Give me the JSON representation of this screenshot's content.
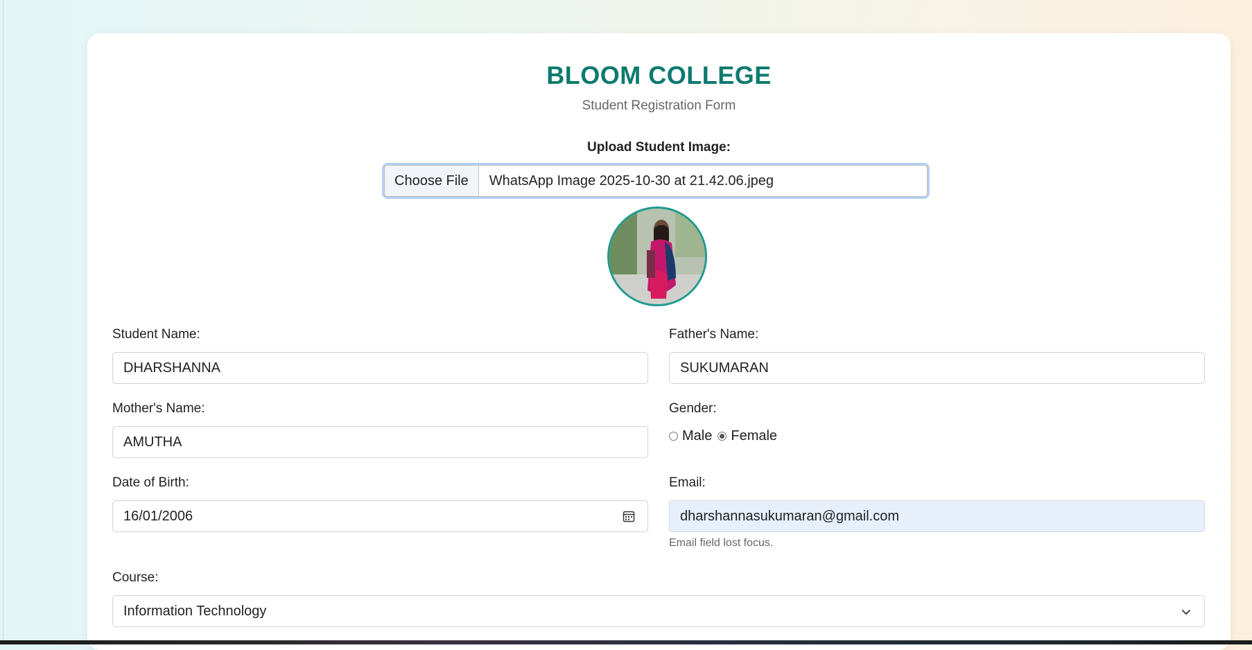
{
  "header": {
    "title": "BLOOM COLLEGE",
    "subtitle": "Student Registration Form"
  },
  "upload": {
    "label": "Upload Student Image:",
    "button_label": "Choose File",
    "file_name": "WhatsApp Image 2025-10-30 at 21.42.06.jpeg"
  },
  "fields": {
    "student_name": {
      "label": "Student Name:",
      "value": "DHARSHANNA"
    },
    "father_name": {
      "label": "Father's Name:",
      "value": "SUKUMARAN"
    },
    "mother_name": {
      "label": "Mother's Name:",
      "value": "AMUTHA"
    },
    "gender": {
      "label": "Gender:",
      "options": [
        "Male",
        "Female"
      ],
      "selected": "Female"
    },
    "dob": {
      "label": "Date of Birth:",
      "value": "16/01/2006"
    },
    "email": {
      "label": "Email:",
      "value": "dharshannasukumaran@gmail.com",
      "help": "Email field lost focus."
    },
    "course": {
      "label": "Course:",
      "value": "Information Technology"
    }
  },
  "icons": {
    "date": "calendar-icon",
    "select": "chevron-down-icon"
  },
  "colors": {
    "brand": "#0d7a6e",
    "avatar_border": "#1f9b8f",
    "focus_ring": "#b6cff3",
    "autofill_bg": "#e7effb"
  }
}
